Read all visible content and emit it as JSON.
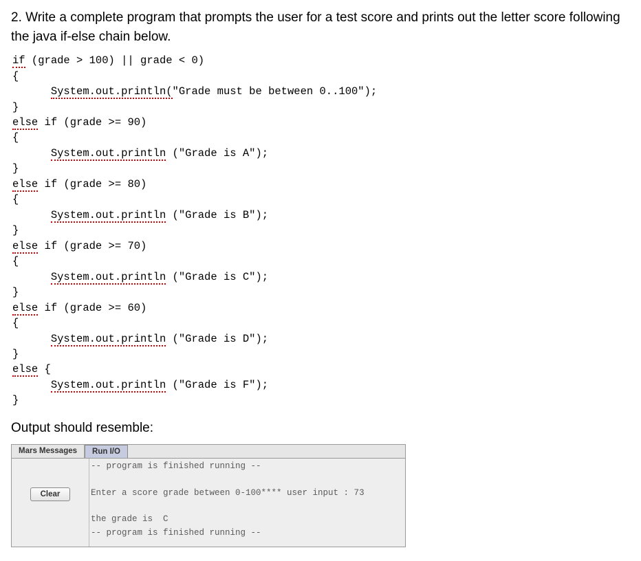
{
  "question": "2. Write a complete program that prompts the user for a test score and prints out the letter score following the java if-else chain below.",
  "code": {
    "l01a": "if",
    "l01b": " (grade > 100) || grade < 0)",
    "l02": "{",
    "l03a": "      ",
    "l03b": "System.out.println(",
    "l03c": "\"Grade must be between 0..100\");",
    "l04": "}",
    "l05a": "else",
    "l05b": " if (grade >= 90)",
    "l06": "{",
    "l07a": "      ",
    "l07b": "System.out.println",
    "l07c": " (\"Grade is A\");",
    "l08": "}",
    "l09a": "else",
    "l09b": " if (grade >= 80)",
    "l10": "{",
    "l11a": "      ",
    "l11b": "System.out.println",
    "l11c": " (\"Grade is B\");",
    "l12": "}",
    "l13a": "else",
    "l13b": " if (grade >= 70)",
    "l14": "{",
    "l15a": "      ",
    "l15b": "System.out.println",
    "l15c": " (\"Grade is C\");",
    "l16": "}",
    "l17a": "else",
    "l17b": " if (grade >= 60)",
    "l18": "{",
    "l19a": "      ",
    "l19b": "System.out.println",
    "l19c": " (\"Grade is D\");",
    "l20": "}",
    "l21a": "else",
    "l21b": " {",
    "l22a": "      ",
    "l22b": "System.out.println",
    "l22c": " (\"Grade is F\");",
    "l23": "}"
  },
  "output_heading": "Output should resemble:",
  "console": {
    "tab_messages": "Mars Messages",
    "tab_runio": "Run I/O",
    "clear_label": "Clear",
    "text": "-- program is finished running --\n\nEnter a score grade between 0-100**** user input : 73\n\nthe grade is  C\n-- program is finished running --"
  }
}
